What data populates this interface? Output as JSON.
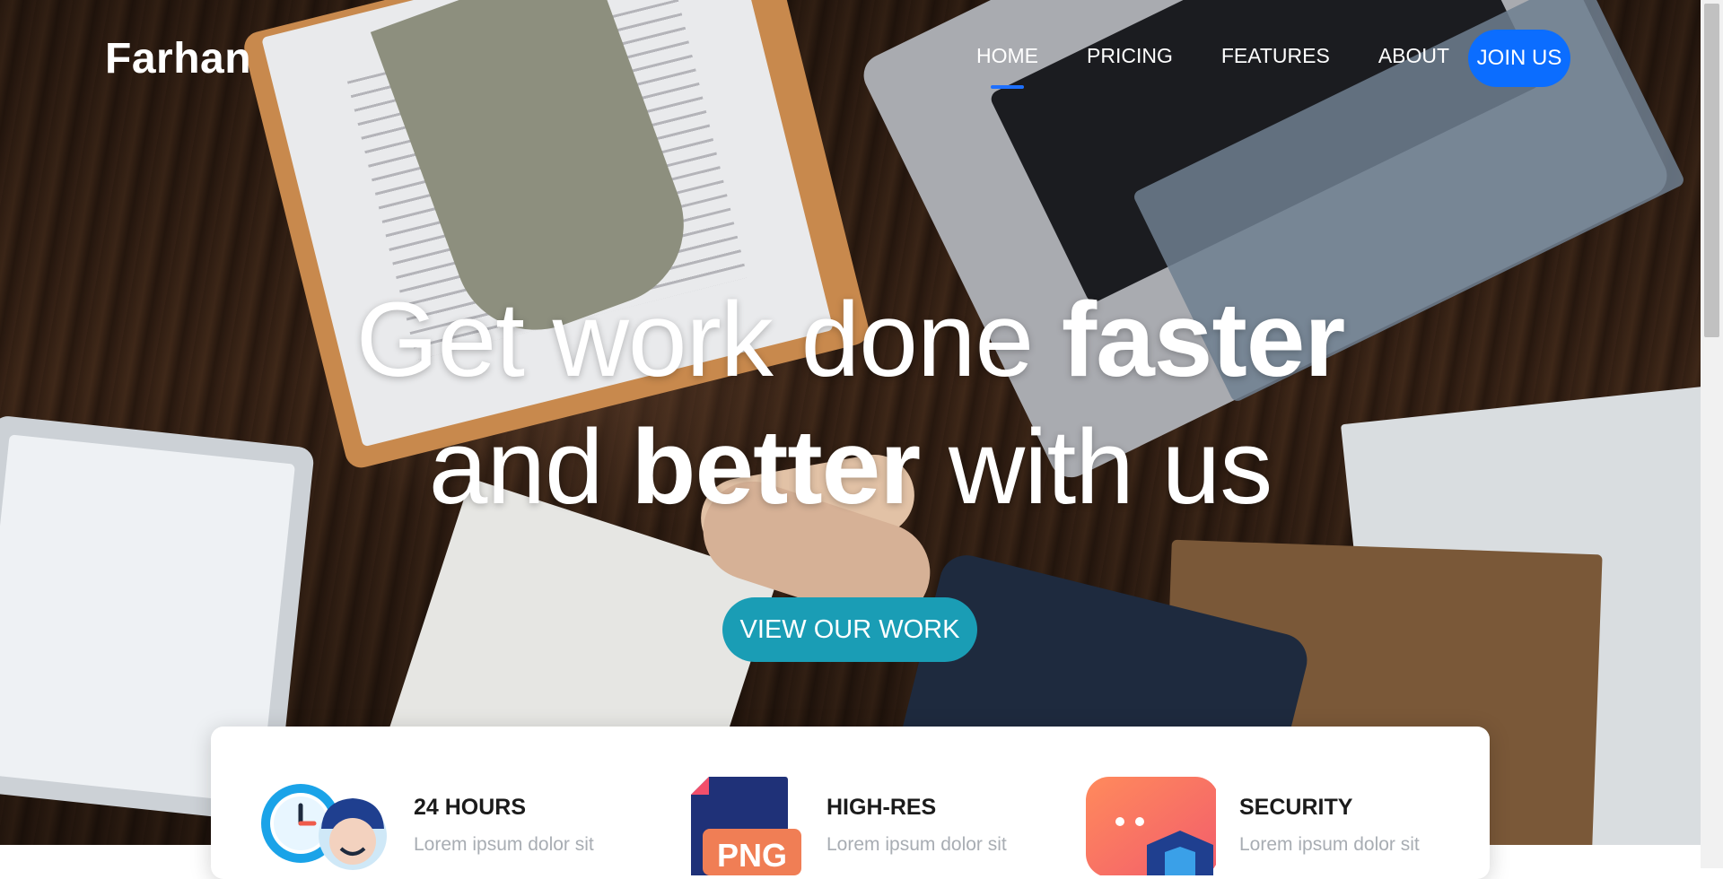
{
  "brand": {
    "name": "Farhan"
  },
  "nav": {
    "items": [
      {
        "label": "HOME",
        "active": true
      },
      {
        "label": "PRICING",
        "active": false
      },
      {
        "label": "FEATURES",
        "active": false
      },
      {
        "label": "ABOUT",
        "active": false
      }
    ],
    "join_label": "JOIN US"
  },
  "hero": {
    "line1_light": "Get work done ",
    "line1_bold": "faster",
    "line2_light_before": "and ",
    "line2_bold": "better",
    "line2_light_after": " with us",
    "cta_label": "VIEW OUR WORK"
  },
  "features": [
    {
      "title": "24 HOURS",
      "desc": "Lorem ipsum dolor sit",
      "icon": "clock-support-icon"
    },
    {
      "title": "HIGH-RES",
      "desc": "Lorem ipsum dolor sit",
      "icon": "png-file-icon"
    },
    {
      "title": "SECURITY",
      "desc": "Lorem ipsum dolor sit",
      "icon": "shield-lock-icon"
    }
  ],
  "colors": {
    "accent_blue": "#0b6dff",
    "cta_teal": "#1a9db5",
    "nav_underline": "#1e70ff"
  }
}
